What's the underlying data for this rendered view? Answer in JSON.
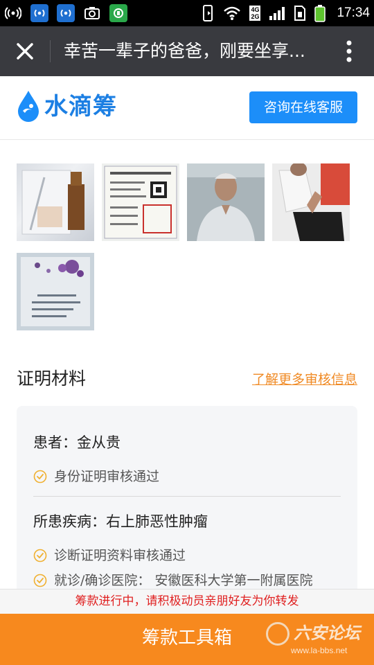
{
  "status_bar": {
    "time": "17:34",
    "network": [
      "4G",
      "2G"
    ],
    "icons": [
      "signal-antenna-icon",
      "signal-antenna-blue-icon",
      "signal-antenna-blue-icon",
      "camera-icon",
      "app-green-icon",
      "phone-vibrate-icon",
      "wifi-icon",
      "cell-signal-icon",
      "sim-icon",
      "battery-icon"
    ]
  },
  "title_bar": {
    "title": "幸苦一辈子的爸爸，刚要坐享..."
  },
  "brand": {
    "name": "水滴筹",
    "consult_button": "咨询在线客服",
    "colors": {
      "brand": "#1c7fe3",
      "button": "#1c8ef9"
    }
  },
  "photos": [
    {
      "name": "medicine-bottle-photo"
    },
    {
      "name": "medical-record-photo"
    },
    {
      "name": "patient-portrait-photo"
    },
    {
      "name": "patient-seated-photo"
    },
    {
      "name": "lab-report-photo"
    }
  ],
  "proof": {
    "section_title": "证明材料",
    "more_link": "了解更多审核信息",
    "patient_label": "患者：金从贵",
    "identity_check": "身份证明审核通过",
    "disease_label": "所患疾病：右上肺恶性肿瘤",
    "diagnosis_check": "诊断证明资料审核通过",
    "hospital_check": "就诊/确诊医院：  安徽医科大学第一附属医院"
  },
  "notice": {
    "text": "筹款进行中，请积极动员亲朋好友为你转发",
    "color": "#e02020"
  },
  "footer": {
    "button": "筹款工具箱",
    "color": "#f7891e",
    "watermark_text": "六安论坛",
    "watermark_url": "www.la-bbs.net"
  }
}
